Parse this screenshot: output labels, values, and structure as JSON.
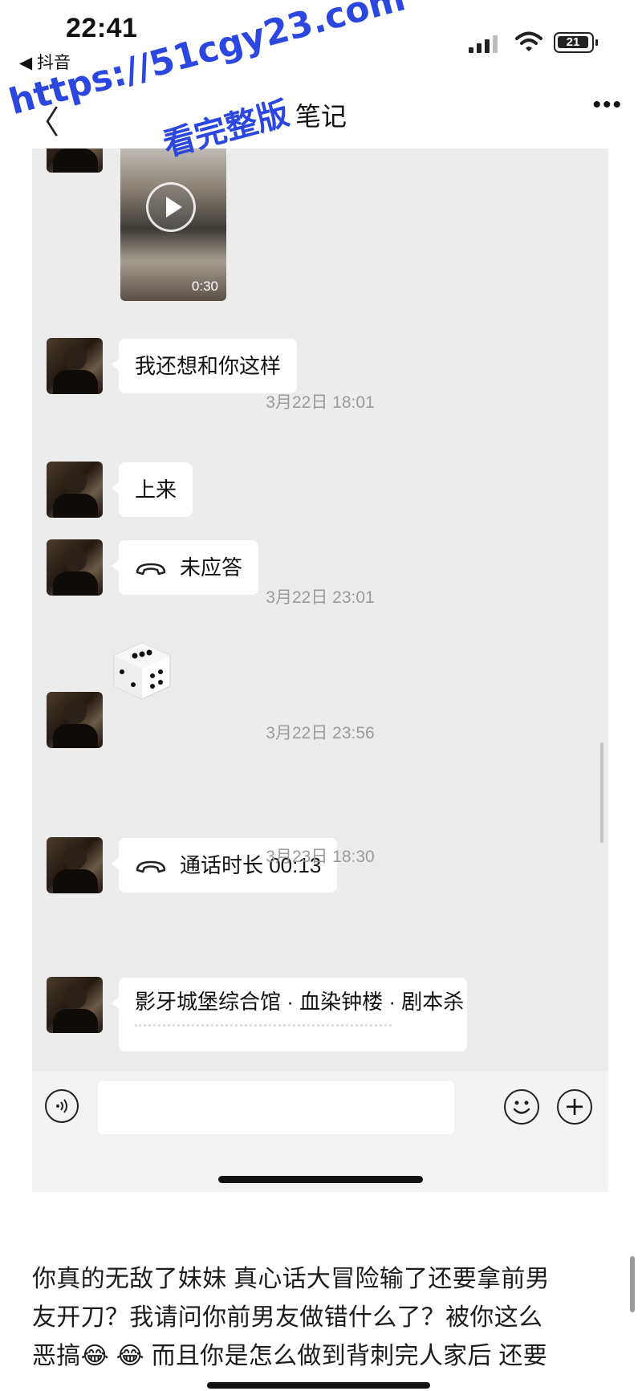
{
  "status_bar": {
    "time": "22:41",
    "back_app": "◀ 抖音",
    "battery": "21"
  },
  "nav": {
    "back": "〈",
    "title": "笔记",
    "more": "•••"
  },
  "watermark": {
    "url": "https://51cgy23.com",
    "subtitle": "看完整版"
  },
  "chat": {
    "video": {
      "duration": "0:30"
    },
    "messages": [
      {
        "type": "text",
        "text": "我还想和你这样"
      },
      {
        "type": "timestamp",
        "text": "3月22日 18:01"
      },
      {
        "type": "text",
        "text": "上来"
      },
      {
        "type": "call",
        "text": "未应答"
      },
      {
        "type": "timestamp",
        "text": "3月22日 23:01"
      },
      {
        "type": "dice"
      },
      {
        "type": "timestamp",
        "text": "3月22日 23:56"
      },
      {
        "type": "call",
        "text": "通话时长 00:13"
      },
      {
        "type": "timestamp",
        "text": "3月23日 18:30"
      },
      {
        "type": "card",
        "text": "影牙城堡综合馆 · 血染钟楼 · 剧本杀"
      }
    ]
  },
  "input_bar": {
    "placeholder": ""
  },
  "caption": {
    "line1": "你真的无敌了妹妹 真心话大冒险输了还要拿前男",
    "line2": "友开刀？我请问你前男友做错什么了？被你这么",
    "line3": "恶搞😂 😂 而且你是怎么做到背刺完人家后 还要"
  }
}
